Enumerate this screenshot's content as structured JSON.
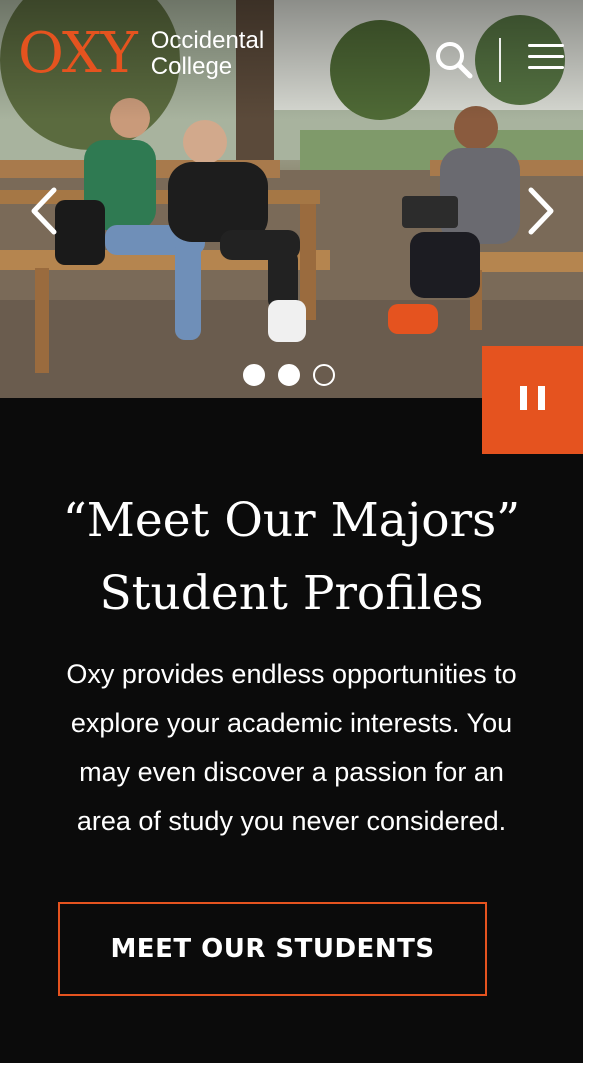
{
  "header": {
    "logo_mark": "OXY",
    "logo_line1": "Occidental",
    "logo_line2": "College",
    "search_icon": "search-icon",
    "menu_icon": "hamburger-menu-icon"
  },
  "carousel": {
    "prev_icon": "chevron-left-icon",
    "next_icon": "chevron-right-icon",
    "pause_icon": "pause-icon",
    "slide_count": 3,
    "active_slide": 2,
    "image_alt": "Three students sitting on wooden benches under trees on campus"
  },
  "content": {
    "headline_line1": "“Meet Our Majors”",
    "headline_line2": "Student Profiles",
    "body_line1": "Oxy provides endless opportunities to",
    "body_line2": "explore your academic interests. You",
    "body_line3": "may even discover a passion for an",
    "body_line4": "area of study you never considered.",
    "cta_label": "MEET OUR STUDENTS"
  },
  "colors": {
    "accent": "#e5531f",
    "background": "#0b0b0b",
    "text": "#ffffff"
  }
}
